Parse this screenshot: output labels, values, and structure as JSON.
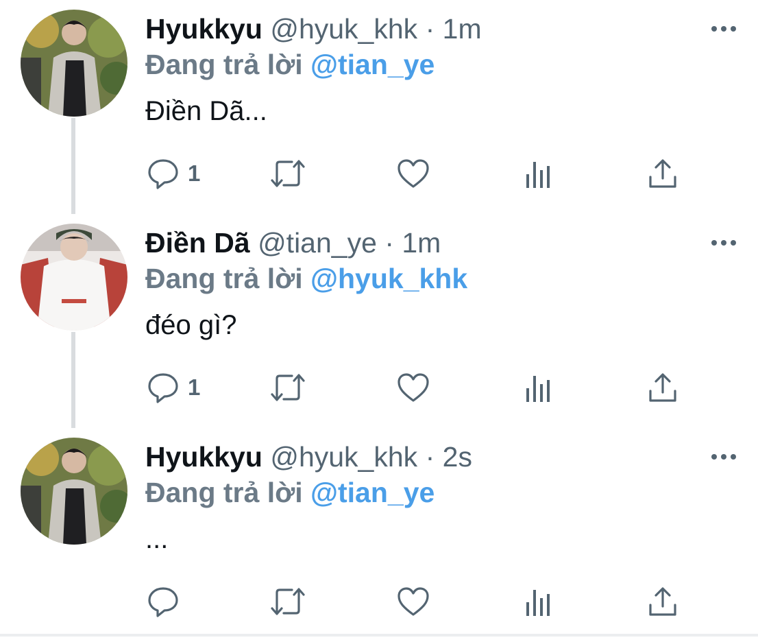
{
  "colors": {
    "text": "#0f1419",
    "secondary": "#536471",
    "reply_prefix": "#6b7a87",
    "mention": "#4a9ee8",
    "thread_line": "#d9dcdf"
  },
  "tweets": [
    {
      "display_name": "Hyukkyu",
      "handle": "@hyuk_khk",
      "separator": "·",
      "time": "1m",
      "reply_prefix": "Đang trả lời",
      "reply_mention": "@tian_ye",
      "text": "Điền Dã...",
      "reply_count": "1",
      "avatar_icon": "avatar-photo-icon"
    },
    {
      "display_name": "Điền Dã",
      "handle": "@tian_ye",
      "separator": "·",
      "time": "1m",
      "reply_prefix": "Đang trả lời",
      "reply_mention": "@hyuk_khk",
      "text": "đéo gì?",
      "reply_count": "1",
      "avatar_icon": "avatar-photo-icon"
    },
    {
      "display_name": "Hyukkyu",
      "handle": "@hyuk_khk",
      "separator": "·",
      "time": "2s",
      "reply_prefix": "Đang trả lời",
      "reply_mention": "@tian_ye",
      "text": "...",
      "reply_count": "",
      "avatar_icon": "avatar-photo-icon"
    }
  ],
  "action_icons": [
    "reply-icon",
    "retweet-icon",
    "like-icon",
    "analytics-icon",
    "share-icon"
  ],
  "more_icon": "more-options-icon"
}
